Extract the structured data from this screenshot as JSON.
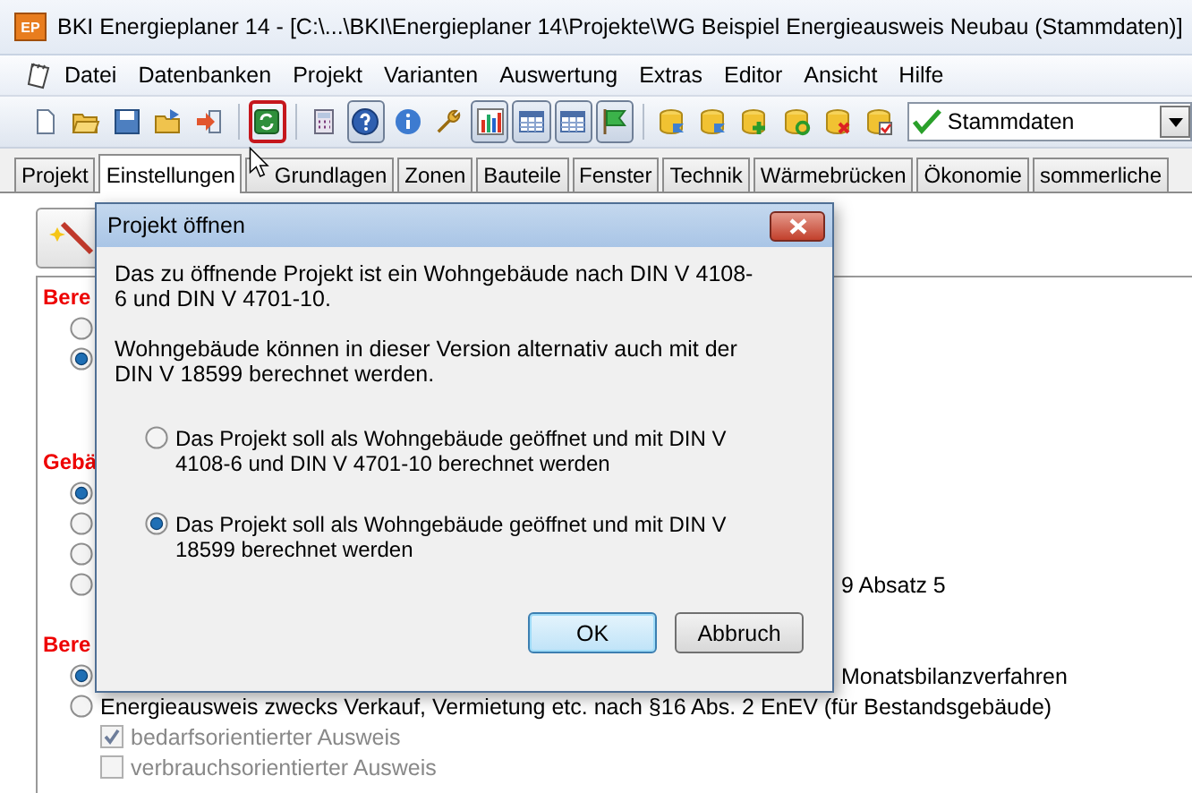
{
  "window": {
    "app_icon_text": "EP",
    "title": "BKI Energieplaner 14 - [C:\\...\\BKI\\Energieplaner 14\\Projekte\\WG Beispiel Energieausweis Neubau (Stammdaten)]"
  },
  "menu": [
    "Datei",
    "Datenbanken",
    "Projekt",
    "Varianten",
    "Auswertung",
    "Extras",
    "Editor",
    "Ansicht",
    "Hilfe"
  ],
  "toolbar": {
    "buttons": [
      {
        "kind": "new",
        "pressed": false,
        "highlighted": false
      },
      {
        "kind": "open",
        "pressed": false,
        "highlighted": false
      },
      {
        "kind": "save",
        "pressed": false,
        "highlighted": false
      },
      {
        "kind": "folder-arrow",
        "pressed": false,
        "highlighted": false
      },
      {
        "kind": "export",
        "pressed": false,
        "highlighted": false
      },
      {
        "kind": "refresh",
        "pressed": false,
        "highlighted": true
      },
      {
        "kind": "calculator",
        "pressed": false,
        "highlighted": false
      },
      {
        "kind": "help",
        "pressed": true,
        "highlighted": false
      },
      {
        "kind": "info",
        "pressed": false,
        "highlighted": false
      },
      {
        "kind": "wrench",
        "pressed": false,
        "highlighted": false
      },
      {
        "kind": "chart",
        "pressed": true,
        "highlighted": false
      },
      {
        "kind": "table",
        "pressed": true,
        "highlighted": false
      },
      {
        "kind": "calendar",
        "pressed": true,
        "highlighted": false
      },
      {
        "kind": "flag",
        "pressed": true,
        "highlighted": false
      },
      {
        "kind": "db-arrow",
        "pressed": false,
        "highlighted": false
      },
      {
        "kind": "db-arrow",
        "pressed": false,
        "highlighted": false
      },
      {
        "kind": "db-plus",
        "pressed": false,
        "highlighted": false
      },
      {
        "kind": "db-refresh",
        "pressed": false,
        "highlighted": false
      },
      {
        "kind": "db-delete",
        "pressed": false,
        "highlighted": false
      },
      {
        "kind": "db-check",
        "pressed": false,
        "highlighted": false
      }
    ],
    "combo": {
      "value": "Stammdaten"
    }
  },
  "tabs": [
    {
      "label": "Projekt",
      "selected": false
    },
    {
      "label": "Einstellungen",
      "selected": true
    },
    {
      "label": "Grundlagen",
      "selected": false
    },
    {
      "label": "Zonen",
      "selected": false
    },
    {
      "label": "Bauteile",
      "selected": false
    },
    {
      "label": "Fenster",
      "selected": false
    },
    {
      "label": "Technik",
      "selected": false
    },
    {
      "label": "Wärmebrücken",
      "selected": false
    },
    {
      "label": "Ökonomie",
      "selected": false
    },
    {
      "label": "sommerliche",
      "selected": false
    }
  ],
  "sections": [
    {
      "heading": "Bere",
      "options": [
        {
          "kind": "covered",
          "selected": false
        },
        {
          "kind": "covered",
          "selected": true
        }
      ]
    },
    {
      "heading": "Gebä",
      "options": [
        {
          "kind": "covered",
          "selected": true
        },
        {
          "kind": "covered",
          "selected": false
        },
        {
          "kind": "covered",
          "selected": false
        },
        {
          "kind": "partly-covered",
          "label": "9 Absatz 5",
          "selected": false
        }
      ]
    },
    {
      "heading": "Bere",
      "options": [
        {
          "kind": "partly-covered",
          "label": "Monatsbilanzverfahren",
          "selected": true
        },
        {
          "kind": "plain",
          "label": "Energieausweis zwecks Verkauf, Vermietung etc. nach §16 Abs. 2 EnEV (für Bestandsgebäude)",
          "selected": false,
          "checkboxes": [
            {
              "label": "bedarfsorientierter Ausweis",
              "checked": true,
              "disabled": true
            },
            {
              "label": "verbrauchsorientierter Ausweis",
              "checked": false,
              "disabled": true
            }
          ]
        }
      ]
    }
  ],
  "dialog": {
    "title": "Projekt öffnen",
    "paragraphs": [
      "Das zu öffnende Projekt ist ein Wohngebäude nach DIN V 4108-6 und DIN V 4701-10.",
      "Wohngebäude können in dieser Version alternativ auch mit der DIN V 18599 berechnet werden."
    ],
    "choices": [
      {
        "label": "Das Projekt soll als Wohngebäude geöffnet und mit DIN V 4108-6 und DIN V 4701-10 berechnet werden",
        "selected": false
      },
      {
        "label": "Das Projekt soll als Wohngebäude geöffnet und mit DIN V 18599 berechnet werden",
        "selected": true
      }
    ],
    "buttons": [
      {
        "label": "OK",
        "default": true
      },
      {
        "label": "Abbruch",
        "default": false
      }
    ]
  }
}
